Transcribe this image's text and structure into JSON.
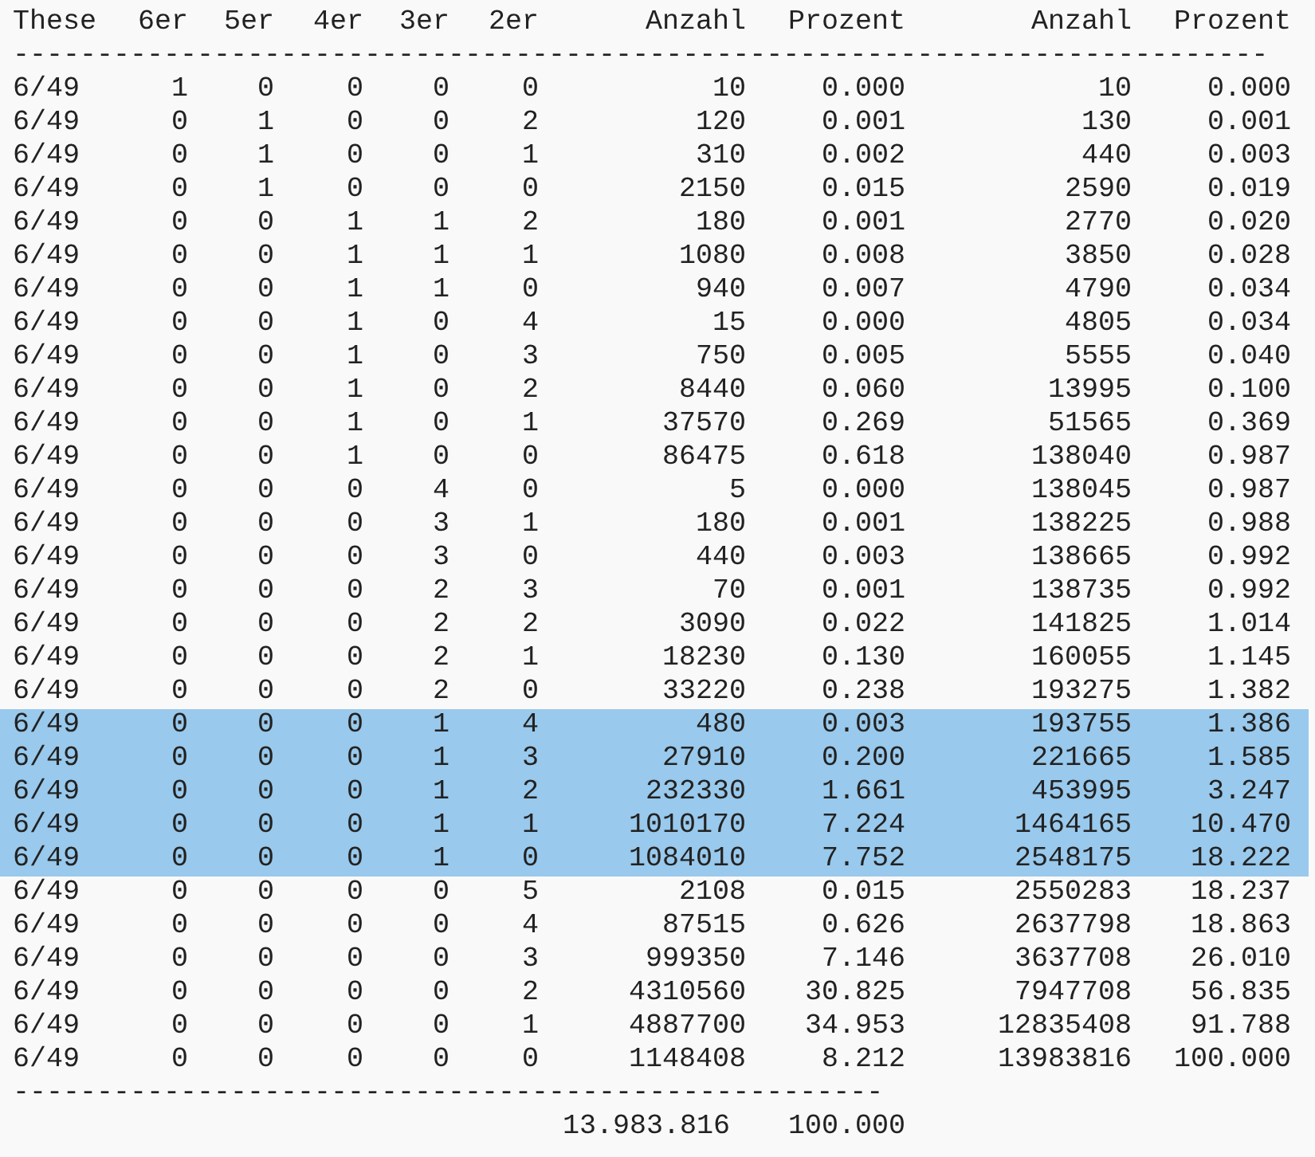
{
  "columns": [
    "These",
    "6er",
    "5er",
    "4er",
    "3er",
    "2er",
    "Anzahl",
    "Prozent",
    "Anzahl",
    "Prozent"
  ],
  "rule_top": "---------------------------------------------------------------------------",
  "rows": [
    {
      "cells": [
        "6/49",
        "1",
        "0",
        "0",
        "0",
        "0",
        "10",
        "0.000",
        "10",
        "0.000"
      ],
      "selected": false
    },
    {
      "cells": [
        "6/49",
        "0",
        "1",
        "0",
        "0",
        "2",
        "120",
        "0.001",
        "130",
        "0.001"
      ],
      "selected": false
    },
    {
      "cells": [
        "6/49",
        "0",
        "1",
        "0",
        "0",
        "1",
        "310",
        "0.002",
        "440",
        "0.003"
      ],
      "selected": false
    },
    {
      "cells": [
        "6/49",
        "0",
        "1",
        "0",
        "0",
        "0",
        "2150",
        "0.015",
        "2590",
        "0.019"
      ],
      "selected": false
    },
    {
      "cells": [
        "6/49",
        "0",
        "0",
        "1",
        "1",
        "2",
        "180",
        "0.001",
        "2770",
        "0.020"
      ],
      "selected": false
    },
    {
      "cells": [
        "6/49",
        "0",
        "0",
        "1",
        "1",
        "1",
        "1080",
        "0.008",
        "3850",
        "0.028"
      ],
      "selected": false
    },
    {
      "cells": [
        "6/49",
        "0",
        "0",
        "1",
        "1",
        "0",
        "940",
        "0.007",
        "4790",
        "0.034"
      ],
      "selected": false
    },
    {
      "cells": [
        "6/49",
        "0",
        "0",
        "1",
        "0",
        "4",
        "15",
        "0.000",
        "4805",
        "0.034"
      ],
      "selected": false
    },
    {
      "cells": [
        "6/49",
        "0",
        "0",
        "1",
        "0",
        "3",
        "750",
        "0.005",
        "5555",
        "0.040"
      ],
      "selected": false
    },
    {
      "cells": [
        "6/49",
        "0",
        "0",
        "1",
        "0",
        "2",
        "8440",
        "0.060",
        "13995",
        "0.100"
      ],
      "selected": false
    },
    {
      "cells": [
        "6/49",
        "0",
        "0",
        "1",
        "0",
        "1",
        "37570",
        "0.269",
        "51565",
        "0.369"
      ],
      "selected": false
    },
    {
      "cells": [
        "6/49",
        "0",
        "0",
        "1",
        "0",
        "0",
        "86475",
        "0.618",
        "138040",
        "0.987"
      ],
      "selected": false
    },
    {
      "cells": [
        "6/49",
        "0",
        "0",
        "0",
        "4",
        "0",
        "5",
        "0.000",
        "138045",
        "0.987"
      ],
      "selected": false
    },
    {
      "cells": [
        "6/49",
        "0",
        "0",
        "0",
        "3",
        "1",
        "180",
        "0.001",
        "138225",
        "0.988"
      ],
      "selected": false
    },
    {
      "cells": [
        "6/49",
        "0",
        "0",
        "0",
        "3",
        "0",
        "440",
        "0.003",
        "138665",
        "0.992"
      ],
      "selected": false
    },
    {
      "cells": [
        "6/49",
        "0",
        "0",
        "0",
        "2",
        "3",
        "70",
        "0.001",
        "138735",
        "0.992"
      ],
      "selected": false
    },
    {
      "cells": [
        "6/49",
        "0",
        "0",
        "0",
        "2",
        "2",
        "3090",
        "0.022",
        "141825",
        "1.014"
      ],
      "selected": false
    },
    {
      "cells": [
        "6/49",
        "0",
        "0",
        "0",
        "2",
        "1",
        "18230",
        "0.130",
        "160055",
        "1.145"
      ],
      "selected": false
    },
    {
      "cells": [
        "6/49",
        "0",
        "0",
        "0",
        "2",
        "0",
        "33220",
        "0.238",
        "193275",
        "1.382"
      ],
      "selected": false
    },
    {
      "cells": [
        "6/49",
        "0",
        "0",
        "0",
        "1",
        "4",
        "480",
        "0.003",
        "193755",
        "1.386"
      ],
      "selected": true
    },
    {
      "cells": [
        "6/49",
        "0",
        "0",
        "0",
        "1",
        "3",
        "27910",
        "0.200",
        "221665",
        "1.585"
      ],
      "selected": true
    },
    {
      "cells": [
        "6/49",
        "0",
        "0",
        "0",
        "1",
        "2",
        "232330",
        "1.661",
        "453995",
        "3.247"
      ],
      "selected": true
    },
    {
      "cells": [
        "6/49",
        "0",
        "0",
        "0",
        "1",
        "1",
        "1010170",
        "7.224",
        "1464165",
        "10.470"
      ],
      "selected": true
    },
    {
      "cells": [
        "6/49",
        "0",
        "0",
        "0",
        "1",
        "0",
        "1084010",
        "7.752",
        "2548175",
        "18.222"
      ],
      "selected": true
    },
    {
      "cells": [
        "6/49",
        "0",
        "0",
        "0",
        "0",
        "5",
        "2108",
        "0.015",
        "2550283",
        "18.237"
      ],
      "selected": false
    },
    {
      "cells": [
        "6/49",
        "0",
        "0",
        "0",
        "0",
        "4",
        "87515",
        "0.626",
        "2637798",
        "18.863"
      ],
      "selected": false
    },
    {
      "cells": [
        "6/49",
        "0",
        "0",
        "0",
        "0",
        "3",
        "999350",
        "7.146",
        "3637708",
        "26.010"
      ],
      "selected": false
    },
    {
      "cells": [
        "6/49",
        "0",
        "0",
        "0",
        "0",
        "2",
        "4310560",
        "30.825",
        "7947708",
        "56.835"
      ],
      "selected": false
    },
    {
      "cells": [
        "6/49",
        "0",
        "0",
        "0",
        "0",
        "1",
        "4887700",
        "34.953",
        "12835408",
        "91.788"
      ],
      "selected": false
    },
    {
      "cells": [
        "6/49",
        "0",
        "0",
        "0",
        "0",
        "0",
        "1148408",
        "8.212",
        "13983816",
        "100.000"
      ],
      "selected": false
    }
  ],
  "rule_bottom": "----------------------------------------------------",
  "totals": {
    "anzahl": "13.983.816",
    "prozent": "100.000"
  }
}
